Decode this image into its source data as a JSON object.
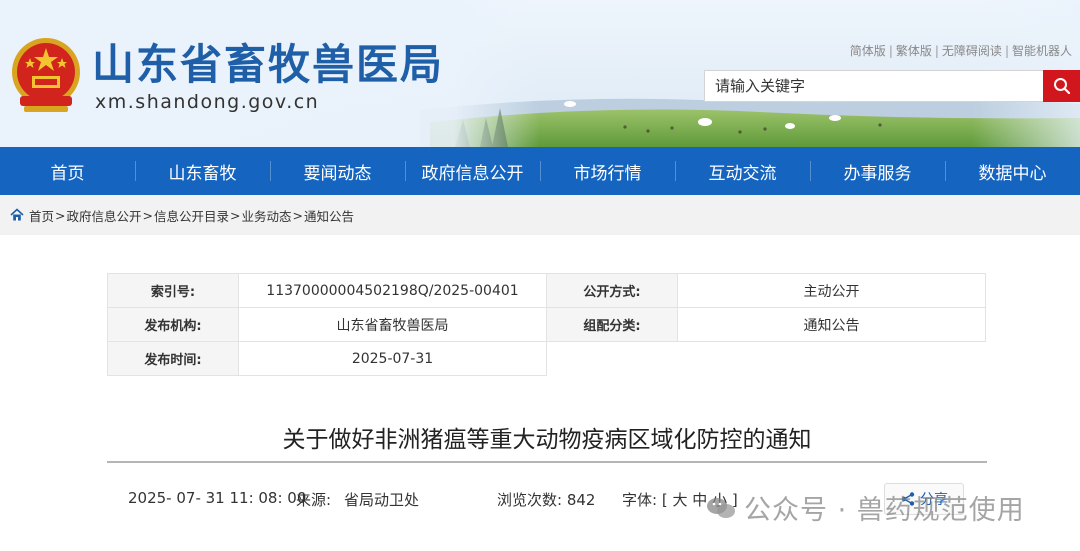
{
  "site": {
    "title": "山东省畜牧兽医局",
    "domain": "xm.shandong.gov.cn"
  },
  "toplinks": [
    "简体版",
    "繁体版",
    "无障碍阅读",
    "智能机器人"
  ],
  "search": {
    "placeholder": "请输入关键字"
  },
  "nav": [
    "首页",
    "山东畜牧",
    "要闻动态",
    "政府信息公开",
    "市场行情",
    "互动交流",
    "办事服务",
    "数据中心"
  ],
  "breadcrumb": [
    "首页",
    "政府信息公开",
    "信息公开目录",
    "业务动态",
    "通知公告"
  ],
  "info": {
    "index_label": "索引号:",
    "index_value": "11370000004502198Q/2025-00401",
    "publish_method_label": "公开方式:",
    "publish_method_value": "主动公开",
    "issuer_label": "发布机构:",
    "issuer_value": "山东省畜牧兽医局",
    "category_label": "组配分类:",
    "category_value": "通知公告",
    "date_label": "发布时间:",
    "date_value": "2025-07-31"
  },
  "article": {
    "title": "关于做好非洲猪瘟等重大动物疫病区域化防控的通知",
    "datetime": "2025- 07- 31 11: 08: 00",
    "source_label": "来源:",
    "source": "省局动卫处",
    "views": "浏览次数: 842",
    "font_label": "字体: [",
    "font_large": "大",
    "font_medium": "中",
    "font_small": "小",
    "font_close": "]",
    "share": "分享"
  },
  "watermark": "公众号 · 兽药规范使用",
  "colors": {
    "nav": "#1565c0",
    "search_button": "#d2161e",
    "title": "#1f5fa8"
  }
}
